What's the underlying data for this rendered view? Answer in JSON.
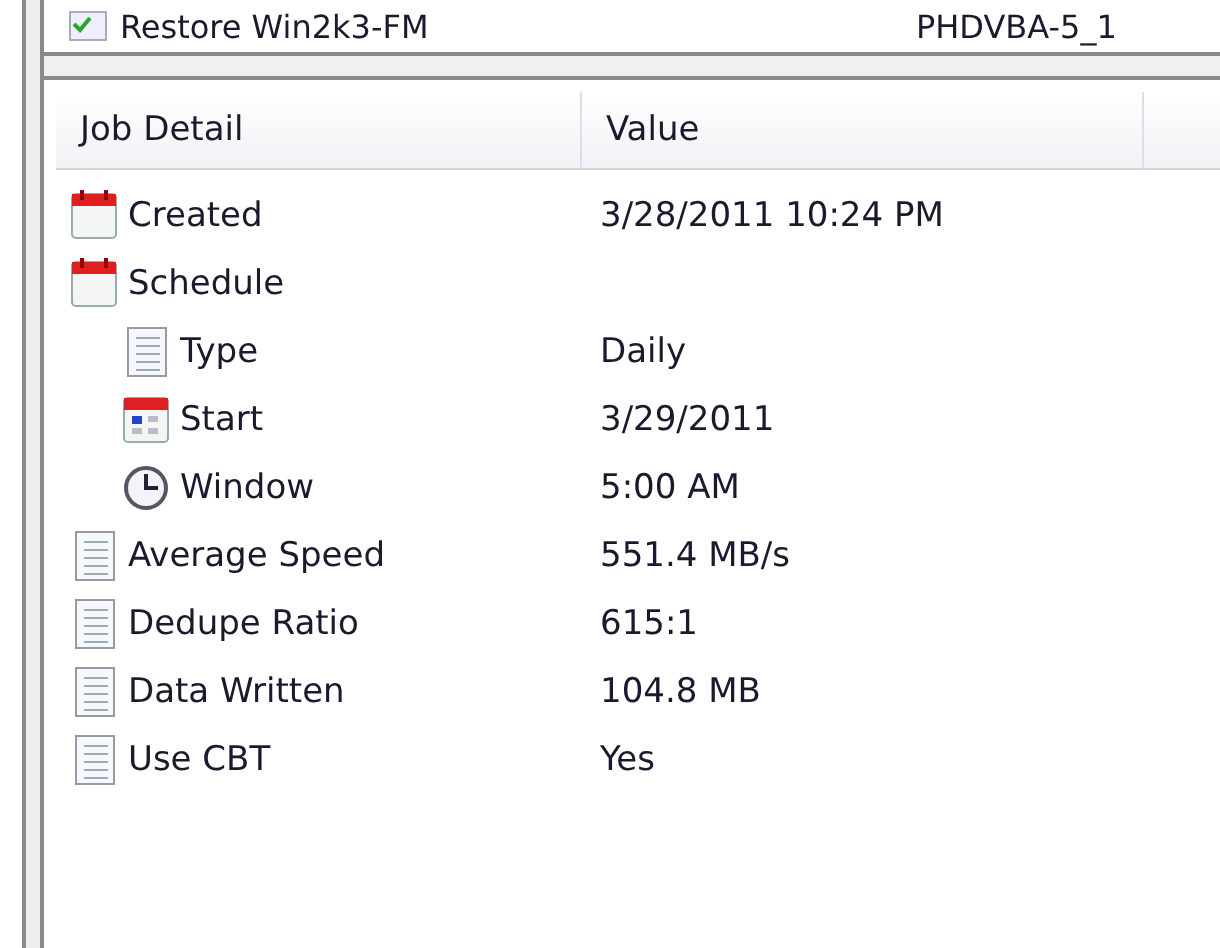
{
  "job_list": {
    "rows": [
      {
        "name": "Restore Win2k3-FM",
        "column_2": "PHDVBA-5_1"
      }
    ]
  },
  "detail_table": {
    "columns": [
      "Job Detail",
      "Value"
    ],
    "rows": [
      {
        "kind": "calendar",
        "label": "Created",
        "value": "3/28/2011 10:24 PM"
      },
      {
        "kind": "calendar",
        "label": "Schedule",
        "children": [
          {
            "kind": "list",
            "label": "Type",
            "value": "Daily"
          },
          {
            "kind": "date",
            "label": "Start",
            "value": "3/29/2011"
          },
          {
            "kind": "time",
            "label": "Window",
            "value": "5:00 AM"
          }
        ]
      },
      {
        "kind": "list",
        "label": "Average Speed",
        "value": "551.4 MB/s"
      },
      {
        "kind": "list",
        "label": "Dedupe Ratio",
        "value": "615:1"
      },
      {
        "kind": "list",
        "label": "Data Written",
        "value": "104.8 MB"
      },
      {
        "kind": "list",
        "label": "Use CBT",
        "value": "Yes"
      }
    ]
  }
}
